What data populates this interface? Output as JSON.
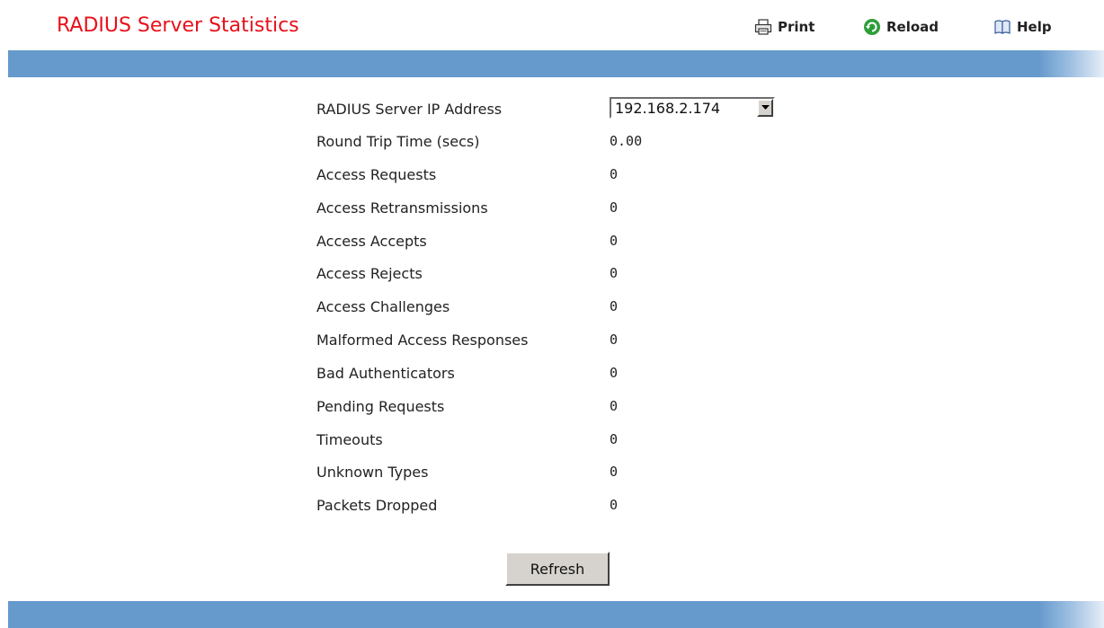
{
  "page": {
    "title": "RADIUS Server Statistics"
  },
  "toolbar": {
    "print_label": "Print",
    "reload_label": "Reload",
    "help_label": "Help",
    "icons": {
      "print": "printer-icon",
      "reload": "reload-icon",
      "help": "help-book-icon"
    }
  },
  "colors": {
    "title": "#e8101a",
    "bar": "#6699cc",
    "reload_icon": "#2e9e3a"
  },
  "server_select": {
    "label": "RADIUS Server IP Address",
    "selected": "192.168.2.174"
  },
  "stats": [
    {
      "label": "Round Trip Time (secs)",
      "value": "0.00"
    },
    {
      "label": "Access Requests",
      "value": "0"
    },
    {
      "label": "Access Retransmissions",
      "value": "0"
    },
    {
      "label": "Access Accepts",
      "value": "0"
    },
    {
      "label": "Access Rejects",
      "value": "0"
    },
    {
      "label": "Access Challenges",
      "value": "0"
    },
    {
      "label": "Malformed Access Responses",
      "value": "0"
    },
    {
      "label": "Bad Authenticators",
      "value": "0"
    },
    {
      "label": "Pending Requests",
      "value": "0"
    },
    {
      "label": "Timeouts",
      "value": "0"
    },
    {
      "label": "Unknown Types",
      "value": "0"
    },
    {
      "label": "Packets Dropped",
      "value": "0"
    }
  ],
  "actions": {
    "refresh_label": "Refresh"
  }
}
